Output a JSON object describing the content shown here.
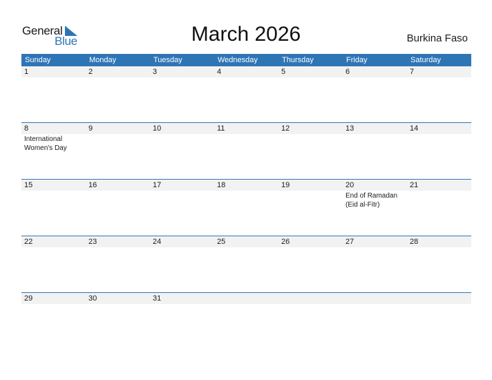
{
  "logo": {
    "word1": "General",
    "word2": "Blue"
  },
  "title": "March 2026",
  "country": "Burkina Faso",
  "colors": {
    "accent": "#2e75b6",
    "strip": "#f2f2f2"
  },
  "weekdays": [
    "Sunday",
    "Monday",
    "Tuesday",
    "Wednesday",
    "Thursday",
    "Friday",
    "Saturday"
  ],
  "weeks": [
    {
      "days": [
        "1",
        "2",
        "3",
        "4",
        "5",
        "6",
        "7"
      ],
      "events": [
        "",
        "",
        "",
        "",
        "",
        "",
        ""
      ]
    },
    {
      "days": [
        "8",
        "9",
        "10",
        "11",
        "12",
        "13",
        "14"
      ],
      "events": [
        "International Women's Day",
        "",
        "",
        "",
        "",
        "",
        ""
      ]
    },
    {
      "days": [
        "15",
        "16",
        "17",
        "18",
        "19",
        "20",
        "21"
      ],
      "events": [
        "",
        "",
        "",
        "",
        "",
        "End of Ramadan (Eid al-Fitr)",
        ""
      ]
    },
    {
      "days": [
        "22",
        "23",
        "24",
        "25",
        "26",
        "27",
        "28"
      ],
      "events": [
        "",
        "",
        "",
        "",
        "",
        "",
        ""
      ]
    },
    {
      "days": [
        "29",
        "30",
        "31",
        "",
        "",
        "",
        ""
      ],
      "events": [
        "",
        "",
        "",
        "",
        "",
        "",
        ""
      ]
    }
  ]
}
